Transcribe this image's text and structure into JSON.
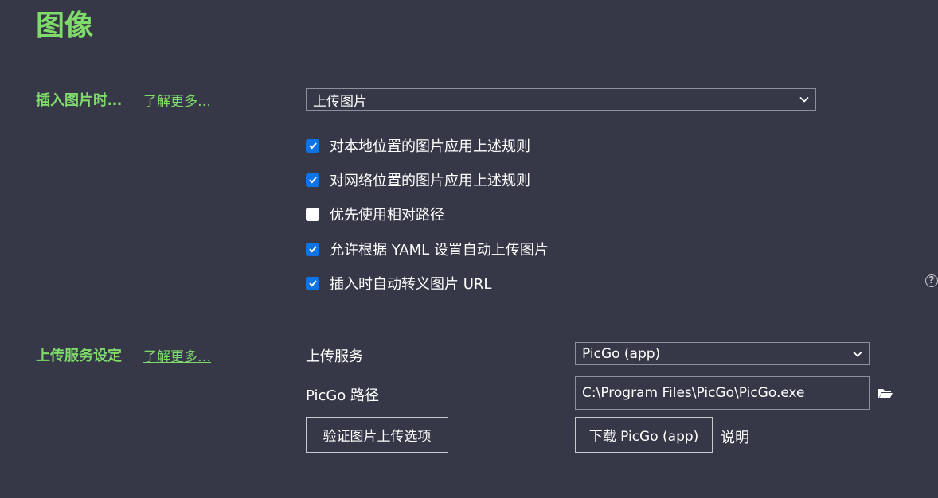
{
  "page": {
    "title": "图像"
  },
  "insert_section": {
    "label": "插入图片时…",
    "learn_more": "了解更多…",
    "select_value": "上传图片",
    "checkboxes": [
      {
        "label": "对本地位置的图片应用上述规则",
        "checked": true
      },
      {
        "label": "对网络位置的图片应用上述规则",
        "checked": true
      },
      {
        "label": "优先使用相对路径",
        "checked": false
      },
      {
        "label": "允许根据 YAML 设置自动上传图片",
        "checked": true
      },
      {
        "label": "插入时自动转义图片 URL",
        "checked": true
      }
    ],
    "help_icon_glyph": "?"
  },
  "upload_section": {
    "label": "上传服务设定",
    "learn_more": "了解更多…",
    "service_label": "上传服务",
    "service_value": "PicGo (app)",
    "path_label": "PicGo 路径",
    "path_value": "C:\\Program Files\\PicGo\\PicGo.exe",
    "verify_button": "验证图片上传选项",
    "download_button": "下载 PicGo (app)",
    "explain_link": "说明"
  },
  "icons": {
    "chevron": "chevron-down-icon",
    "checkmark": "checkmark-icon",
    "help": "help-circle-icon",
    "folder": "folder-icon"
  },
  "colors": {
    "background": "#363847",
    "accent_green": "#7fdb6a",
    "checkbox_blue": "#0a74e8",
    "border": "#8c8f9c"
  }
}
